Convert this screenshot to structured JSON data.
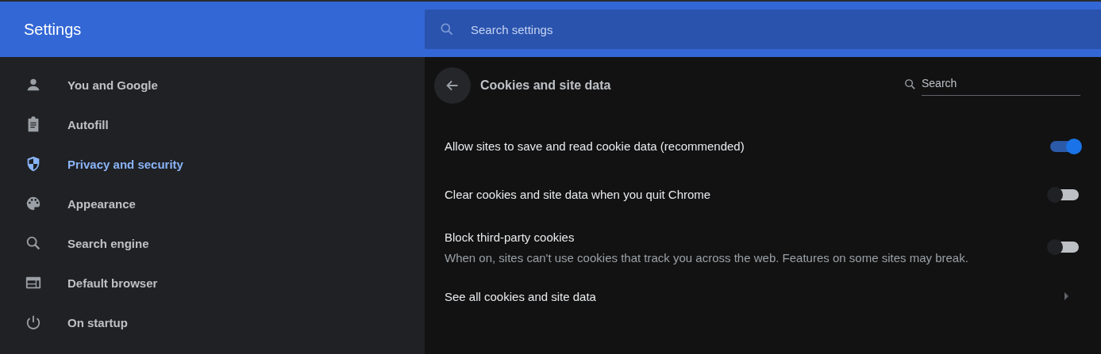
{
  "header": {
    "title": "Settings",
    "search": {
      "placeholder": "Search settings"
    }
  },
  "sidebar": {
    "items": [
      {
        "label": "You and Google",
        "selected": false
      },
      {
        "label": "Autofill",
        "selected": false
      },
      {
        "label": "Privacy and security",
        "selected": true
      },
      {
        "label": "Appearance",
        "selected": false
      },
      {
        "label": "Search engine",
        "selected": false
      },
      {
        "label": "Default browser",
        "selected": false
      },
      {
        "label": "On startup",
        "selected": false
      }
    ]
  },
  "page": {
    "title": "Cookies and site data",
    "search": {
      "placeholder": "Search"
    },
    "rows": [
      {
        "kind": "toggle",
        "label": "Allow sites to save and read cookie data (recommended)",
        "on": true
      },
      {
        "kind": "toggle",
        "label": "Clear cookies and site data when you quit Chrome",
        "on": false
      },
      {
        "kind": "toggle",
        "label": "Block third-party cookies",
        "description": "When on, sites can't use cookies that track you across the web. Features on some sites may break.",
        "on": false
      },
      {
        "kind": "link",
        "label": "See all cookies and site data"
      }
    ]
  }
}
